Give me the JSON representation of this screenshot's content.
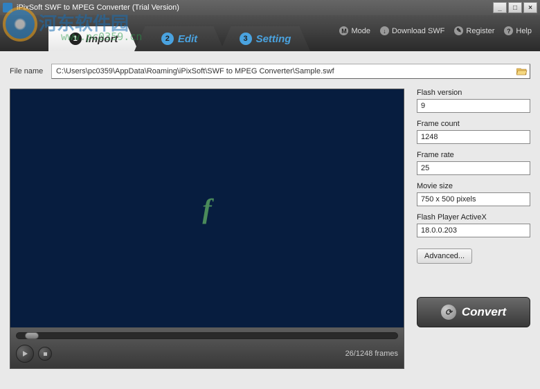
{
  "window": {
    "title": "iPixSoft SWF to MPEG Converter (Trial Version)"
  },
  "watermark": {
    "text": "河东软件园",
    "sub": "www.pc0359.cn"
  },
  "tabs": {
    "t1": {
      "num": "1",
      "label": "Import"
    },
    "t2": {
      "num": "2",
      "label": "Edit"
    },
    "t3": {
      "num": "3",
      "label": "Setting"
    }
  },
  "toolbar": {
    "mode": {
      "icon": "M",
      "label": "Mode"
    },
    "download": {
      "icon": "↓",
      "label": "Download SWF"
    },
    "register": {
      "icon": "✎",
      "label": "Register"
    },
    "help": {
      "icon": "?",
      "label": "Help"
    }
  },
  "file": {
    "label": "File name",
    "path": "C:\\Users\\pc0359\\AppData\\Roaming\\iPixSoft\\SWF to MPEG Converter\\Sample.swf"
  },
  "player": {
    "counter": "26/1248 frames"
  },
  "props": {
    "flash_version": {
      "label": "Flash version",
      "value": "9"
    },
    "frame_count": {
      "label": "Frame count",
      "value": "1248"
    },
    "frame_rate": {
      "label": "Frame rate",
      "value": "25"
    },
    "movie_size": {
      "label": "Movie size",
      "value": "750 x 500 pixels"
    },
    "activex": {
      "label": "Flash Player ActiveX",
      "value": "18.0.0.203"
    }
  },
  "buttons": {
    "advanced": "Advanced...",
    "convert": "Convert"
  }
}
